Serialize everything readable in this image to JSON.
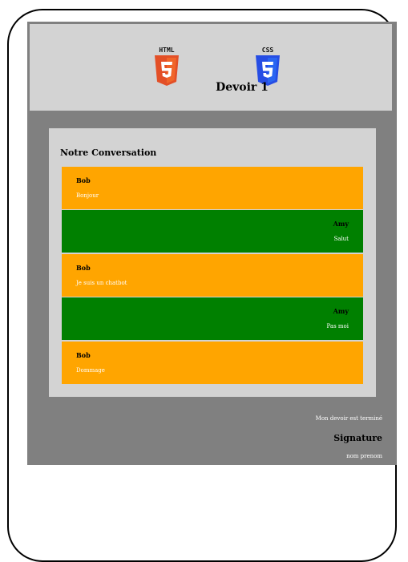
{
  "header": {
    "title": "Devoir 1",
    "logos": [
      {
        "name": "html5-logo",
        "label": "HTML",
        "number": "5",
        "color": "#e34f26"
      },
      {
        "name": "css3-logo",
        "label": "CSS",
        "number": "3",
        "color": "#1572b6"
      }
    ]
  },
  "conversation": {
    "title": "Notre Conversation",
    "messages": [
      {
        "sender": "Bob",
        "text": "Bonjour"
      },
      {
        "sender": "Amy",
        "text": "Salut"
      },
      {
        "sender": "Bob",
        "text": "Je suis un chatbot"
      },
      {
        "sender": "Amy",
        "text": "Pas moi"
      },
      {
        "sender": "Bob",
        "text": "Dommage"
      }
    ]
  },
  "footer": {
    "done": "Mon devoir est terminé",
    "signature": "Signature",
    "name": "nom prenom"
  },
  "colors": {
    "bob": "#ffa500",
    "amy": "#008000",
    "page_bg": "#808080",
    "panel_bg": "#d3d3d3"
  }
}
